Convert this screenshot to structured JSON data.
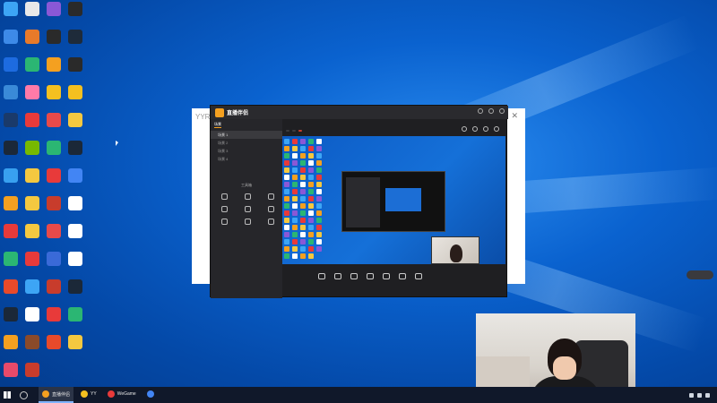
{
  "desktop": {
    "icons": [
      {
        "label": "",
        "color": "#3da5f5"
      },
      {
        "label": "",
        "color": "#e8e8e8"
      },
      {
        "label": "",
        "color": "#8a58d6"
      },
      {
        "label": "",
        "color": "#2a2a2a"
      },
      {
        "label": "",
        "color": "#3d8ae8"
      },
      {
        "label": "",
        "color": "#e87a2a"
      },
      {
        "label": "",
        "color": "#2a2a2a"
      },
      {
        "label": "",
        "color": "#1e2b3a"
      },
      {
        "label": "",
        "color": "#1d6be0"
      },
      {
        "label": "",
        "color": "#2bb673"
      },
      {
        "label": "",
        "color": "#f4a020"
      },
      {
        "label": "",
        "color": "#2a2a2a"
      },
      {
        "label": "",
        "color": "#3a8ad8"
      },
      {
        "label": "",
        "color": "#ff7aa8"
      },
      {
        "label": "",
        "color": "#f4c020"
      },
      {
        "label": "",
        "color": "#f4c020"
      },
      {
        "label": "",
        "color": "#1a3a6a"
      },
      {
        "label": "",
        "color": "#e83a3a"
      },
      {
        "label": "",
        "color": "#e84a4a"
      },
      {
        "label": "",
        "color": "#f4c840"
      },
      {
        "label": "",
        "color": "#1b2838"
      },
      {
        "label": "",
        "color": "#76b900"
      },
      {
        "label": "",
        "color": "#2bb673"
      },
      {
        "label": "",
        "color": "#1b2838"
      },
      {
        "label": "",
        "color": "#38a0f0"
      },
      {
        "label": "",
        "color": "#f4c840"
      },
      {
        "label": "",
        "color": "#e83a3a"
      },
      {
        "label": "",
        "color": "#4285f4"
      },
      {
        "label": "",
        "color": "#f4a020"
      },
      {
        "label": "",
        "color": "#f4c840"
      },
      {
        "label": "",
        "color": "#c83c2c"
      },
      {
        "label": "",
        "color": "#ffffff"
      },
      {
        "label": "",
        "color": "#e83a3a"
      },
      {
        "label": "",
        "color": "#f4c840"
      },
      {
        "label": "",
        "color": "#e84a4a"
      },
      {
        "label": "",
        "color": "#ffffff"
      },
      {
        "label": "",
        "color": "#2bb673"
      },
      {
        "label": "",
        "color": "#e83a3a"
      },
      {
        "label": "",
        "color": "#3a6ad8"
      },
      {
        "label": "",
        "color": "#ffffff"
      },
      {
        "label": "",
        "color": "#e84a2a"
      },
      {
        "label": "",
        "color": "#3da5f5"
      },
      {
        "label": "",
        "color": "#c83c2c"
      },
      {
        "label": "",
        "color": "#1b2838"
      },
      {
        "label": "",
        "color": "#1b2838"
      },
      {
        "label": "",
        "color": "#ffffff"
      },
      {
        "label": "",
        "color": "#e83a3a"
      },
      {
        "label": "",
        "color": "#2bb673"
      },
      {
        "label": "",
        "color": "#f4a020"
      },
      {
        "label": "",
        "color": "#8a4a2a"
      },
      {
        "label": "",
        "color": "#e84a2a"
      },
      {
        "label": "",
        "color": "#f4c840"
      },
      {
        "label": "",
        "color": "#e84a6a"
      },
      {
        "label": "",
        "color": "#c83c2c"
      }
    ]
  },
  "back_window": {
    "title": "YYR"
  },
  "app": {
    "brand": "直播伴侣",
    "version": "",
    "tabs": [
      "场景",
      "",
      ""
    ],
    "scenes": [
      "场景 1",
      "场景 2",
      "场景 3",
      "场景 4"
    ],
    "tools_title": "工具箱",
    "tools": [
      "",
      "",
      "",
      "",
      "",
      "",
      "",
      "",
      ""
    ],
    "stream_title": "",
    "chips": [
      "",
      "",
      ""
    ],
    "controls": [
      "",
      "",
      "",
      "",
      "",
      "",
      ""
    ],
    "go_live": "",
    "footer_left": "",
    "footer_right": ""
  },
  "taskbar": {
    "items": [
      {
        "label": "直播伴侣",
        "color": "#f4a020",
        "active": true
      },
      {
        "label": "YY",
        "color": "#f4c020",
        "active": false
      },
      {
        "label": "WeGame",
        "color": "#e83a3a",
        "active": false
      },
      {
        "label": "",
        "color": "#4285f4",
        "active": false
      }
    ],
    "time": "",
    "date": ""
  }
}
